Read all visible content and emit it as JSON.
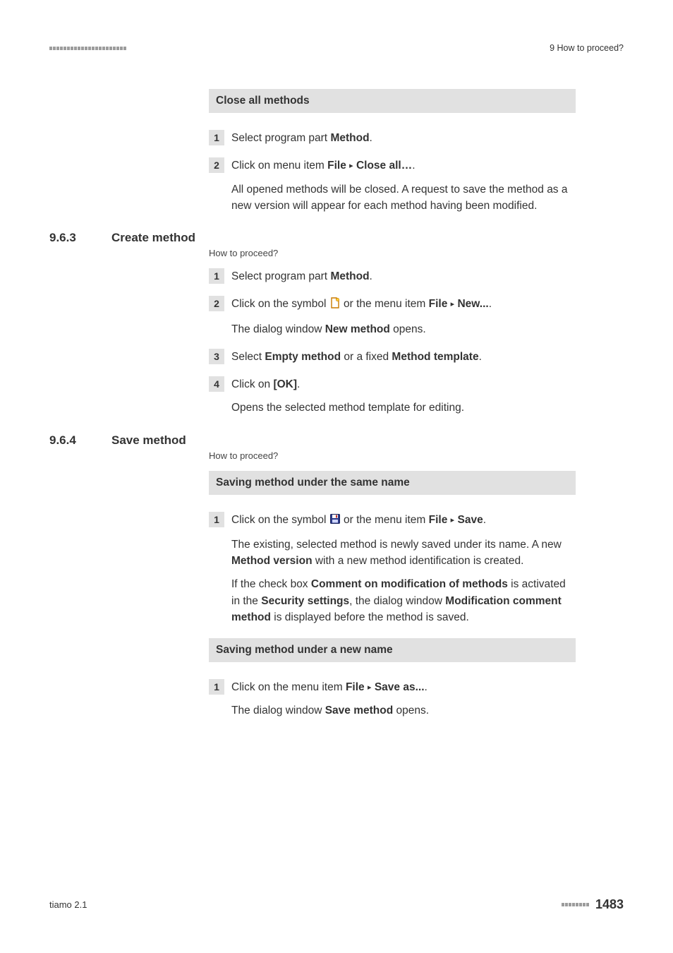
{
  "header": {
    "running_head": "9 How to proceed?"
  },
  "blocks": {
    "close_all": {
      "title": "Close all methods",
      "steps": [
        {
          "num": "1",
          "parts": [
            {
              "t": "Select program part "
            },
            {
              "t": "Method",
              "b": true
            },
            {
              "t": "."
            }
          ]
        },
        {
          "num": "2",
          "parts": [
            {
              "t": "Click on menu item "
            },
            {
              "t": "File",
              "b": true
            },
            {
              "t": " "
            },
            {
              "tri": true
            },
            {
              "t": " "
            },
            {
              "t": "Close all…",
              "b": true
            },
            {
              "t": "."
            }
          ],
          "after": [
            [
              {
                "t": "All opened methods will be closed. A request to save the method as a new version will appear for each method having been modified."
              }
            ]
          ]
        }
      ]
    },
    "create": {
      "sec_num": "9.6.3",
      "sec_title": "Create method",
      "howto": "How to proceed?",
      "steps": [
        {
          "num": "1",
          "parts": [
            {
              "t": "Select program part "
            },
            {
              "t": "Method",
              "b": true
            },
            {
              "t": "."
            }
          ]
        },
        {
          "num": "2",
          "parts": [
            {
              "t": "Click on the symbol "
            },
            {
              "icon": "new"
            },
            {
              "t": " or the menu item "
            },
            {
              "t": "File",
              "b": true
            },
            {
              "t": " "
            },
            {
              "tri": true
            },
            {
              "t": " "
            },
            {
              "t": "New...",
              "b": true
            },
            {
              "t": "."
            }
          ],
          "after": [
            [
              {
                "t": "The dialog window "
              },
              {
                "t": "New method",
                "b": true
              },
              {
                "t": " opens."
              }
            ]
          ]
        },
        {
          "num": "3",
          "parts": [
            {
              "t": "Select "
            },
            {
              "t": "Empty method",
              "b": true
            },
            {
              "t": " or a fixed "
            },
            {
              "t": "Method template",
              "b": true
            },
            {
              "t": "."
            }
          ]
        },
        {
          "num": "4",
          "parts": [
            {
              "t": "Click on "
            },
            {
              "t": "[OK]",
              "b": true
            },
            {
              "t": "."
            }
          ],
          "after": [
            [
              {
                "t": "Opens the selected method template for editing."
              }
            ]
          ]
        }
      ]
    },
    "save": {
      "sec_num": "9.6.4",
      "sec_title": "Save method",
      "howto": "How to proceed?",
      "block1_title": "Saving method under the same name",
      "block1_steps": [
        {
          "num": "1",
          "parts": [
            {
              "t": "Click on the symbol "
            },
            {
              "icon": "save"
            },
            {
              "t": " or the menu item "
            },
            {
              "t": "File",
              "b": true
            },
            {
              "t": " "
            },
            {
              "tri": true
            },
            {
              "t": " "
            },
            {
              "t": "Save",
              "b": true
            },
            {
              "t": "."
            }
          ],
          "after": [
            [
              {
                "t": "The existing, selected method is newly saved under its name. A new "
              },
              {
                "t": "Method version",
                "b": true
              },
              {
                "t": " with a new method identification is created."
              }
            ],
            [
              {
                "t": "If the check box "
              },
              {
                "t": "Comment on modification of methods",
                "b": true
              },
              {
                "t": " is activated in the "
              },
              {
                "t": "Security settings",
                "b": true
              },
              {
                "t": ", the dialog window "
              },
              {
                "t": "Modification comment method",
                "b": true
              },
              {
                "t": " is displayed before the method is saved."
              }
            ]
          ]
        }
      ],
      "block2_title": "Saving method under a new name",
      "block2_steps": [
        {
          "num": "1",
          "parts": [
            {
              "t": "Click on the menu item "
            },
            {
              "t": "File",
              "b": true
            },
            {
              "t": " "
            },
            {
              "tri": true
            },
            {
              "t": " "
            },
            {
              "t": "Save as...",
              "b": true
            },
            {
              "t": "."
            }
          ],
          "after": [
            [
              {
                "t": "The dialog window "
              },
              {
                "t": "Save method",
                "b": true
              },
              {
                "t": " opens."
              }
            ]
          ]
        }
      ]
    }
  },
  "footer": {
    "product": "tiamo 2.1",
    "page": "1483"
  },
  "glyphs": {
    "triangle": "▸"
  }
}
